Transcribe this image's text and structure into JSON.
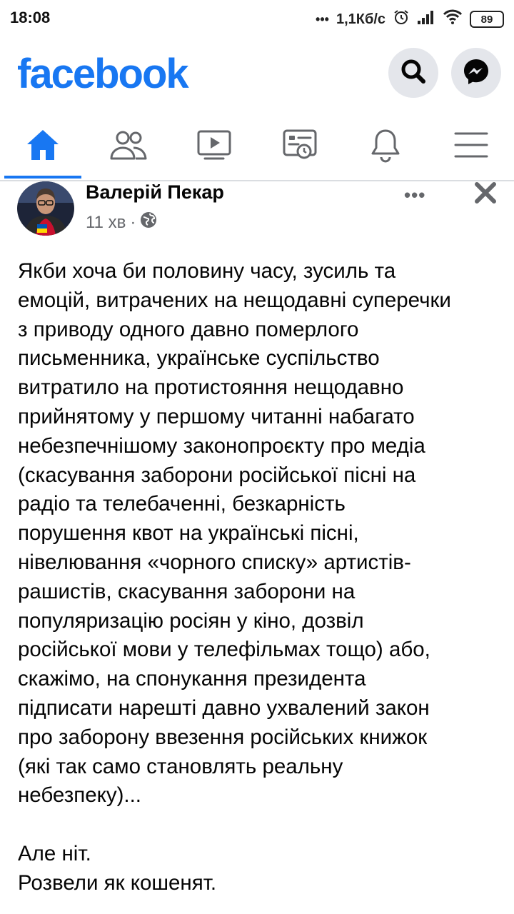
{
  "status_bar": {
    "time": "18:08",
    "dots": "•••",
    "network_speed": "1,1Кб/с",
    "battery": "89"
  },
  "header": {
    "logo": "facebook"
  },
  "icons": {
    "search": "search-icon",
    "messenger": "messenger-icon",
    "home": "home-icon",
    "friends": "friends-icon",
    "watch": "video-icon",
    "feeds": "news-feed-icon",
    "notifications": "bell-icon",
    "menu": "hamburger-menu-icon",
    "privacy": "globe-icon",
    "close": "close-icon"
  },
  "colors": {
    "brand": "#1877f2",
    "nav_icon": "#65676b",
    "text": "#050505",
    "secondary_text": "#65676b"
  },
  "post": {
    "author": "Валерій Пекар",
    "time": "11 хв",
    "separator": "·",
    "more": "•••",
    "text": "Якби хоча би половину часу, зусиль та\nемоцій, витрачених на нещодавні суперечки\nз приводу одного давно померлого\nписьменника, українське суспільство\nвитратило на протистояння нещодавно\nприйнятому у першому читанні набагато\nнебезпечнішому законопроєкту про медіа\n(скасування заборони російської пісні на\nрадіо та телебаченні, безкарність\nпорушення квот на українські пісні,\nнівелювання «чорного списку» артистів-\nрашистів, скасування заборони на\nпопуляризацію росіян у кіно, дозвіл\nросійської мови у телефільмах тощо) або,\nскажімо, на спонукання президента\nпідписати нарешті давно ухвалений закон\nпро заборону ввезення російських книжок\n(які так само становлять реальну\nнебезпеку)...\n\nАле ніт.\nРозвели як кошенят."
  }
}
